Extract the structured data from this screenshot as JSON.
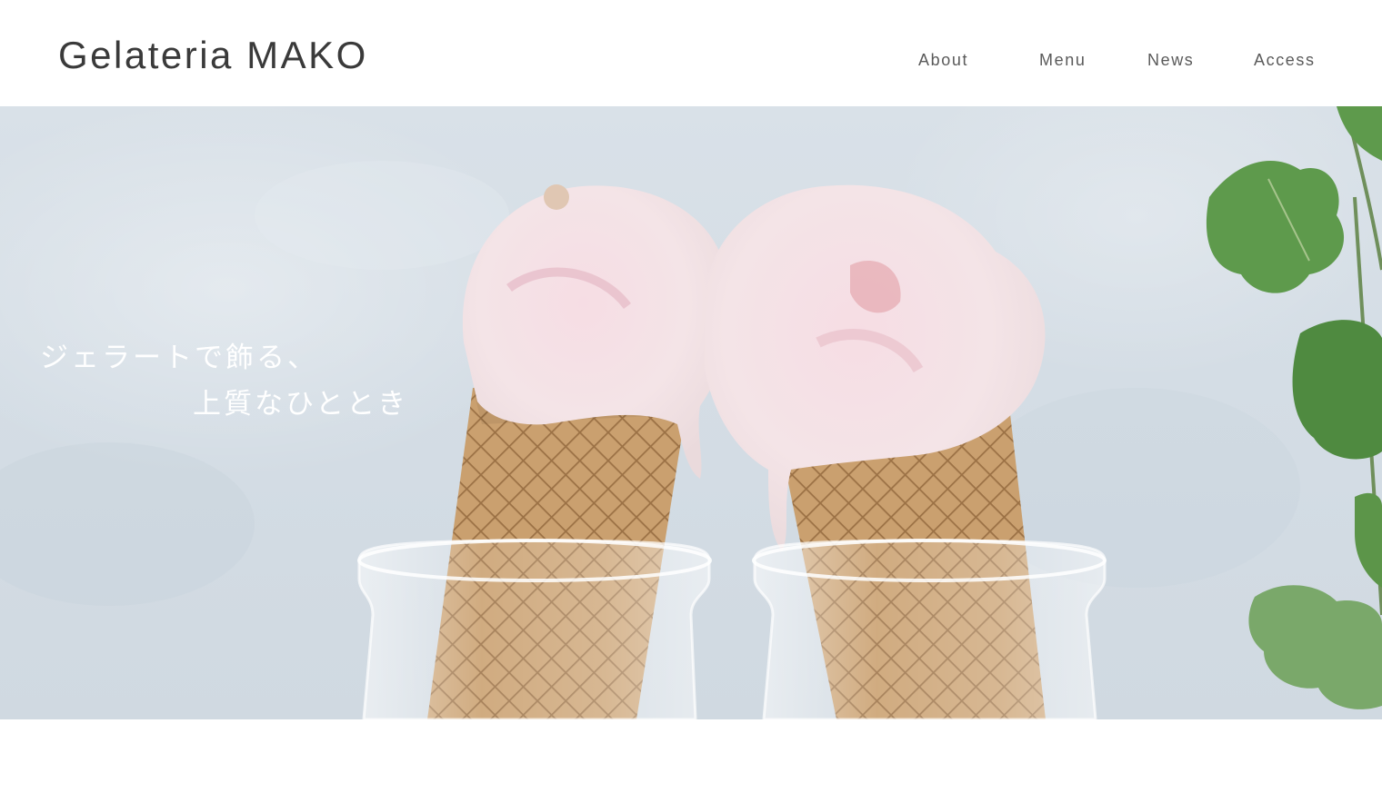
{
  "header": {
    "logo": "Gelateria MAKO",
    "nav": [
      {
        "label": "About"
      },
      {
        "label": "Menu"
      },
      {
        "label": "News"
      },
      {
        "label": "Access"
      }
    ]
  },
  "hero": {
    "tagline_line1": "ジェラートで飾る、",
    "tagline_line2": "上質なひととき",
    "image": "two-ice-cream-cones-in-glass-jars-photo"
  },
  "colors": {
    "background": "#ffffff",
    "text": "#3a3a3a",
    "nav_text": "#5a5a5a",
    "hero_bg": "#d4dde5",
    "ice_cream": "#f3dde1",
    "cone": "#c89a68",
    "leaf": "#5f9a4d"
  }
}
